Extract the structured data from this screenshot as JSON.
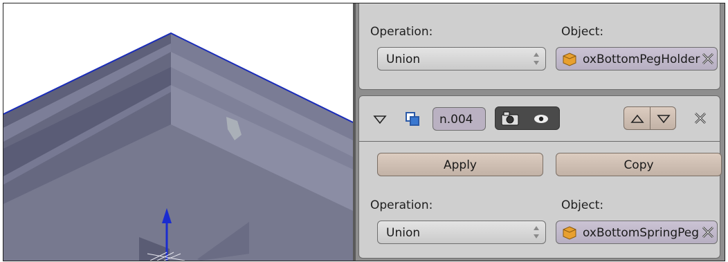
{
  "modifier_top": {
    "operation_label": "Operation:",
    "object_label": "Object:",
    "operation_value": "Union",
    "object_value": "oxBottomPegHolder"
  },
  "modifier_header": {
    "name_value": "n.004"
  },
  "modifier_bottom": {
    "apply_label": "Apply",
    "copy_label": "Copy",
    "operation_label": "Operation:",
    "object_label": "Object:",
    "operation_value": "Union",
    "object_value": "oxBottomSpringPeg"
  },
  "icons": [
    "expand-triangle-icon",
    "boolean-modifier-icon",
    "camera-render-icon",
    "eye-visibility-icon",
    "move-up-icon",
    "move-down-icon",
    "remove-x-icon",
    "object-cube-icon",
    "clear-field-x-icon",
    "transform-z-arrow-icon"
  ],
  "colors": {
    "panel_bg": "#cfcfcf",
    "object_field": "#bdb5c8",
    "button": "#cfbfb3",
    "edge_highlight": "#1a2cb8"
  }
}
